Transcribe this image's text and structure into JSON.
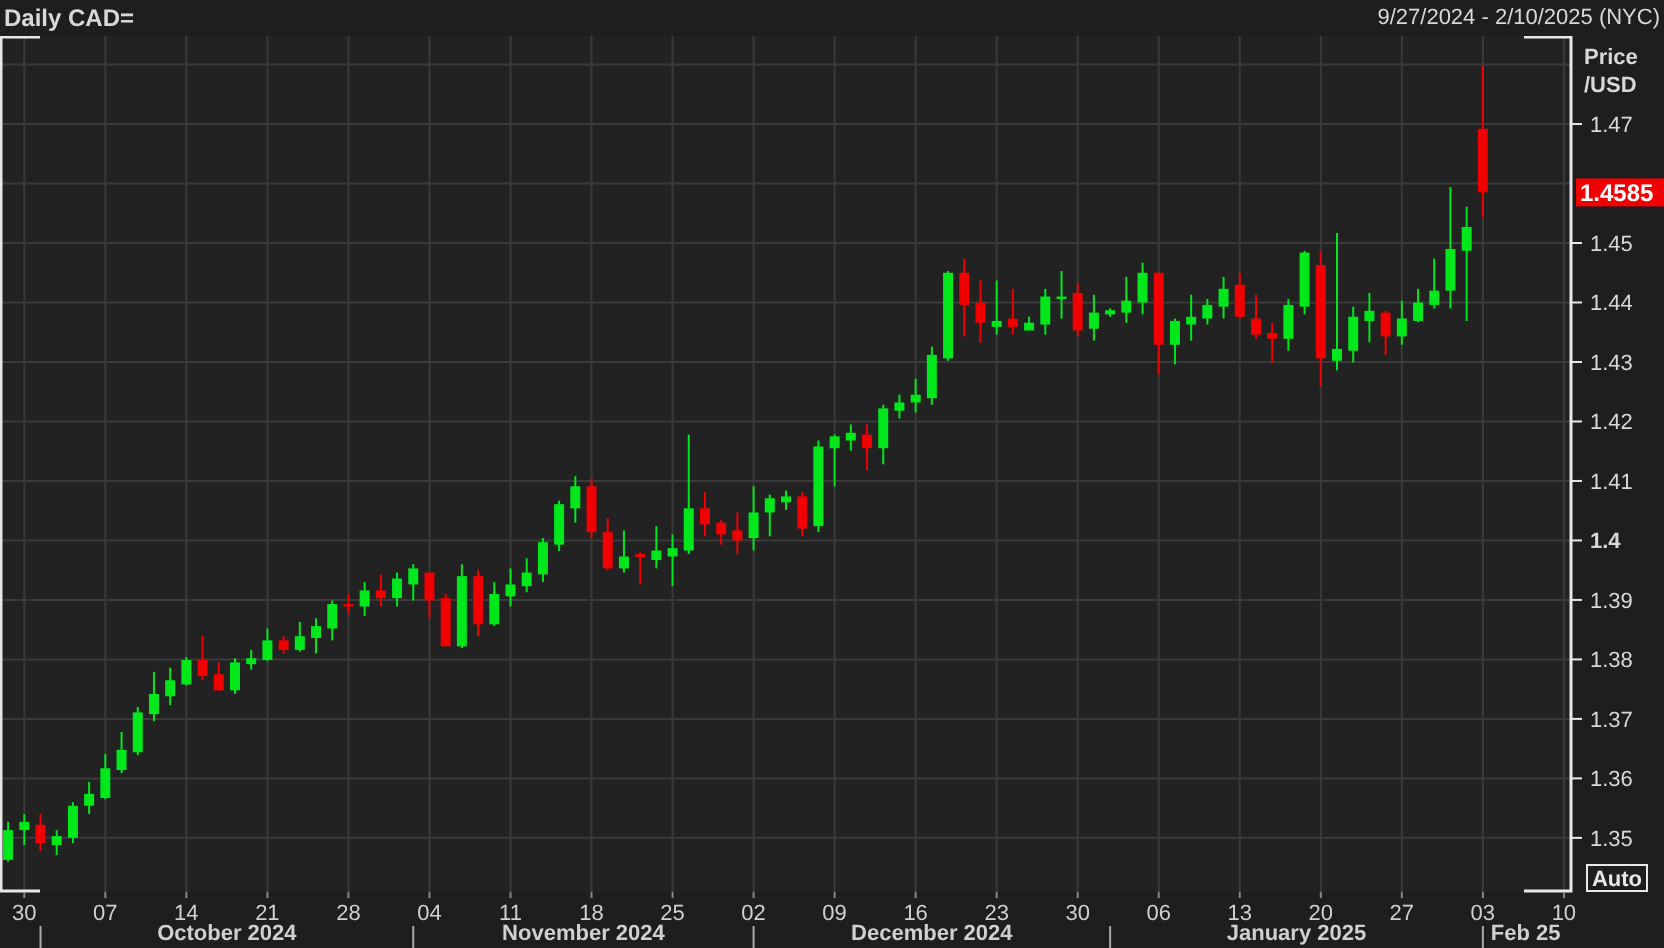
{
  "header": {
    "title": "Daily CAD=",
    "range": "9/27/2024 - 2/10/2025 (NYC)"
  },
  "chart": {
    "last_price": "1.4585",
    "auto_button": "Auto",
    "months": [
      "October 2024",
      "November 2024",
      "December 2024",
      "January 2025",
      "Feb 25"
    ],
    "chart_data": {
      "type": "candlestick",
      "ylabel": "Price /USD",
      "grid": true,
      "ylim": [
        1.3409,
        1.4848
      ],
      "yticks": [
        1.47,
        1.45,
        1.44,
        1.43,
        1.42,
        1.41,
        {
          "value": 1.4,
          "label": "1.4"
        },
        1.39,
        1.38,
        1.37,
        1.36,
        1.35
      ],
      "categories": [
        null,
        "30",
        null,
        null,
        null,
        null,
        "07",
        null,
        null,
        null,
        null,
        "14",
        null,
        null,
        null,
        null,
        "21",
        null,
        null,
        null,
        null,
        "28",
        null,
        null,
        null,
        null,
        "04",
        null,
        null,
        null,
        null,
        "11",
        null,
        null,
        null,
        null,
        "18",
        null,
        null,
        null,
        null,
        "25",
        null,
        null,
        null,
        null,
        "02",
        null,
        null,
        null,
        null,
        "09",
        null,
        null,
        null,
        null,
        "16",
        null,
        null,
        null,
        null,
        "23",
        null,
        null,
        null,
        null,
        "30",
        null,
        null,
        null,
        null,
        "06",
        null,
        null,
        null,
        null,
        "13",
        null,
        null,
        null,
        null,
        "20",
        null,
        null,
        null,
        null,
        "27",
        null,
        null,
        null,
        null,
        "03",
        null,
        null,
        null,
        null,
        "10"
      ],
      "ohlc": [
        [
          1.3463,
          1.3527,
          1.346,
          1.3513
        ],
        [
          1.3513,
          1.354,
          1.3488,
          1.3527
        ],
        [
          1.3522,
          1.354,
          1.3478,
          1.3491
        ],
        [
          1.3488,
          1.3513,
          1.3471,
          1.3503
        ],
        [
          1.35,
          1.356,
          1.3491,
          1.3554
        ],
        [
          1.3554,
          1.3594,
          1.354,
          1.3574
        ],
        [
          1.3567,
          1.3641,
          1.3565,
          1.3617
        ],
        [
          1.3614,
          1.3678,
          1.3609,
          1.3648
        ],
        [
          1.3644,
          1.372,
          1.3639,
          1.3711
        ],
        [
          1.3708,
          1.3779,
          1.3696,
          1.3742
        ],
        [
          1.3738,
          1.3786,
          1.3723,
          1.3765
        ],
        [
          1.3758,
          1.3804,
          1.3756,
          1.3799
        ],
        [
          1.3799,
          1.384,
          1.3766,
          1.3772
        ],
        [
          1.3775,
          1.3795,
          1.3747,
          1.3748
        ],
        [
          1.3748,
          1.3802,
          1.3742,
          1.3795
        ],
        [
          1.3792,
          1.3816,
          1.3783,
          1.3802
        ],
        [
          1.3799,
          1.3852,
          1.3797,
          1.3832
        ],
        [
          1.3832,
          1.3839,
          1.381,
          1.3816
        ],
        [
          1.3816,
          1.3863,
          1.3813,
          1.3839
        ],
        [
          1.3836,
          1.3869,
          1.381,
          1.3856
        ],
        [
          1.3852,
          1.3899,
          1.3832,
          1.3893
        ],
        [
          1.3893,
          1.391,
          1.3876,
          1.3892
        ],
        [
          1.3889,
          1.393,
          1.3873,
          1.3916
        ],
        [
          1.3916,
          1.3943,
          1.3889,
          1.3903
        ],
        [
          1.3903,
          1.3946,
          1.3889,
          1.3936
        ],
        [
          1.3926,
          1.396,
          1.3899,
          1.3953
        ],
        [
          1.3946,
          1.3946,
          1.3869,
          1.3899
        ],
        [
          1.3903,
          1.391,
          1.3822,
          1.3822
        ],
        [
          1.3822,
          1.396,
          1.3819,
          1.394
        ],
        [
          1.394,
          1.395,
          1.3839,
          1.3859
        ],
        [
          1.3859,
          1.393,
          1.3856,
          1.391
        ],
        [
          1.3906,
          1.3953,
          1.3889,
          1.3926
        ],
        [
          1.3923,
          1.397,
          1.3913,
          1.3946
        ],
        [
          1.3943,
          1.4004,
          1.393,
          1.3997
        ],
        [
          1.3993,
          1.4067,
          1.3982,
          1.4061
        ],
        [
          1.4054,
          1.4108,
          1.403,
          1.4091
        ],
        [
          1.4091,
          1.4104,
          1.4004,
          1.4014
        ],
        [
          1.4014,
          1.4037,
          1.395,
          1.3953
        ],
        [
          1.3953,
          1.4017,
          1.3946,
          1.3973
        ],
        [
          1.3977,
          1.398,
          1.3926,
          1.3972
        ],
        [
          1.3967,
          1.4024,
          1.3953,
          1.3983
        ],
        [
          1.3973,
          1.401,
          1.3923,
          1.3987
        ],
        [
          1.3983,
          1.4178,
          1.3977,
          1.4054
        ],
        [
          1.4054,
          1.4081,
          1.4007,
          1.4027
        ],
        [
          1.403,
          1.4034,
          1.3993,
          1.401
        ],
        [
          1.4017,
          1.4047,
          1.3977,
          1.4
        ],
        [
          1.4004,
          1.4091,
          1.3983,
          1.4047
        ],
        [
          1.4047,
          1.4077,
          1.4007,
          1.4071
        ],
        [
          1.4064,
          1.4084,
          1.4051,
          1.4074
        ],
        [
          1.4074,
          1.4081,
          1.4007,
          1.402
        ],
        [
          1.4024,
          1.4168,
          1.4014,
          1.4158
        ],
        [
          1.4155,
          1.4178,
          1.4091,
          1.4175
        ],
        [
          1.4168,
          1.4195,
          1.4151,
          1.4181
        ],
        [
          1.4178,
          1.4195,
          1.4118,
          1.4155
        ],
        [
          1.4155,
          1.4228,
          1.4128,
          1.4222
        ],
        [
          1.4218,
          1.4245,
          1.4205,
          1.4232
        ],
        [
          1.4232,
          1.4272,
          1.4215,
          1.4245
        ],
        [
          1.4239,
          1.4326,
          1.4228,
          1.4312
        ],
        [
          1.4306,
          1.4453,
          1.4302,
          1.445
        ],
        [
          1.445,
          1.4474,
          1.4343,
          1.4396
        ],
        [
          1.44,
          1.4437,
          1.4333,
          1.4366
        ],
        [
          1.4359,
          1.4437,
          1.4346,
          1.4369
        ],
        [
          1.4373,
          1.4423,
          1.4346,
          1.4359
        ],
        [
          1.4353,
          1.4376,
          1.4353,
          1.4366
        ],
        [
          1.4363,
          1.4423,
          1.4346,
          1.441
        ],
        [
          1.4406,
          1.4453,
          1.4373,
          1.441
        ],
        [
          1.4416,
          1.4433,
          1.4343,
          1.4353
        ],
        [
          1.4356,
          1.4413,
          1.4336,
          1.4383
        ],
        [
          1.438,
          1.439,
          1.4376,
          1.4387
        ],
        [
          1.4383,
          1.4443,
          1.4366,
          1.4403
        ],
        [
          1.44,
          1.4467,
          1.438,
          1.445
        ],
        [
          1.445,
          1.445,
          1.4279,
          1.4329
        ],
        [
          1.4329,
          1.4373,
          1.4296,
          1.4369
        ],
        [
          1.4363,
          1.4413,
          1.4336,
          1.4376
        ],
        [
          1.4373,
          1.4406,
          1.4363,
          1.4396
        ],
        [
          1.4393,
          1.4443,
          1.4373,
          1.4423
        ],
        [
          1.443,
          1.445,
          1.4373,
          1.4376
        ],
        [
          1.4373,
          1.4413,
          1.4339,
          1.4346
        ],
        [
          1.4349,
          1.4366,
          1.4299,
          1.4339
        ],
        [
          1.4339,
          1.4406,
          1.4319,
          1.4396
        ],
        [
          1.4393,
          1.4487,
          1.438,
          1.4484
        ],
        [
          1.4463,
          1.4487,
          1.4259,
          1.4306
        ],
        [
          1.4302,
          1.4517,
          1.4286,
          1.4322
        ],
        [
          1.4319,
          1.4393,
          1.4299,
          1.4376
        ],
        [
          1.4369,
          1.4416,
          1.4333,
          1.4386
        ],
        [
          1.4383,
          1.4386,
          1.4312,
          1.4343
        ],
        [
          1.4343,
          1.4403,
          1.4329,
          1.4373
        ],
        [
          1.4369,
          1.4423,
          1.4367,
          1.44
        ],
        [
          1.4396,
          1.4474,
          1.439,
          1.442
        ],
        [
          1.442,
          1.4594,
          1.439,
          1.449
        ],
        [
          1.4487,
          1.4561,
          1.4369,
          1.4527
        ],
        [
          1.4692,
          1.4799,
          1.4544,
          1.4585
        ],
        null,
        null,
        null,
        null,
        null
      ]
    }
  }
}
